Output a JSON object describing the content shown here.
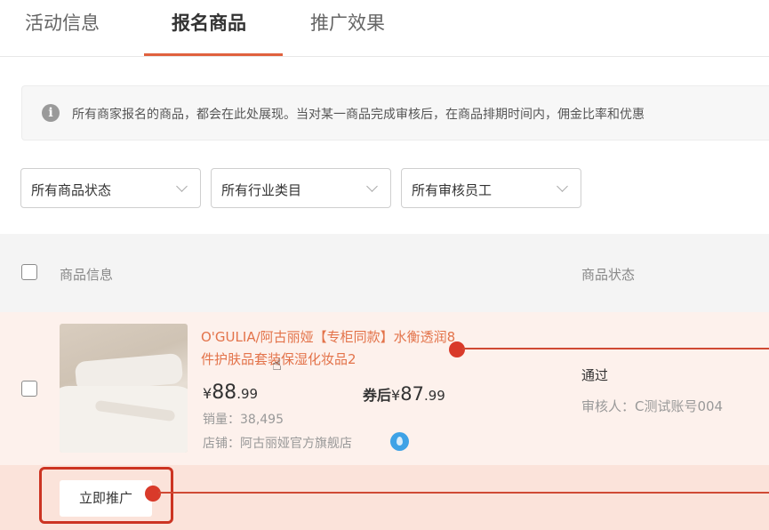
{
  "tabs": [
    {
      "label": "活动信息",
      "active": false
    },
    {
      "label": "报名商品",
      "active": true
    },
    {
      "label": "推广效果",
      "active": false
    }
  ],
  "notice": {
    "icon": "info-icon",
    "text": "所有商家报名的商品，都会在此处展现。当对某一商品完成审核后，在商品排期时间内，佣金比率和优惠"
  },
  "filters": [
    {
      "label": "所有商品状态",
      "icon": "chevron-down-icon"
    },
    {
      "label": "所有行业类目",
      "icon": "chevron-down-icon"
    },
    {
      "label": "所有审核员工",
      "icon": "chevron-down-icon"
    }
  ],
  "table": {
    "headers": {
      "info": "商品信息",
      "status": "商品状态"
    },
    "rows": [
      {
        "title": "O'GULIA/阿古丽娅【专柜同款】水衡透润8件护肤品套装保湿化妆品2",
        "price_symbol": "¥",
        "price_int": "88",
        "price_dec": ".99",
        "coupon_label": "券后",
        "coupon_symbol": "¥",
        "coupon_int": "87",
        "coupon_dec": ".99",
        "sales": "销量：38,495",
        "shop": "店铺：阿古丽娅官方旗舰店",
        "status": "通过",
        "reviewer": "审核人：C测试账号004"
      }
    ]
  },
  "actions": {
    "promote_label": "立即推广"
  },
  "colors": {
    "accent": "#e0613e",
    "link": "#e3734a",
    "annotation": "#d93a2a",
    "row_bg": "#fdf1ec"
  }
}
